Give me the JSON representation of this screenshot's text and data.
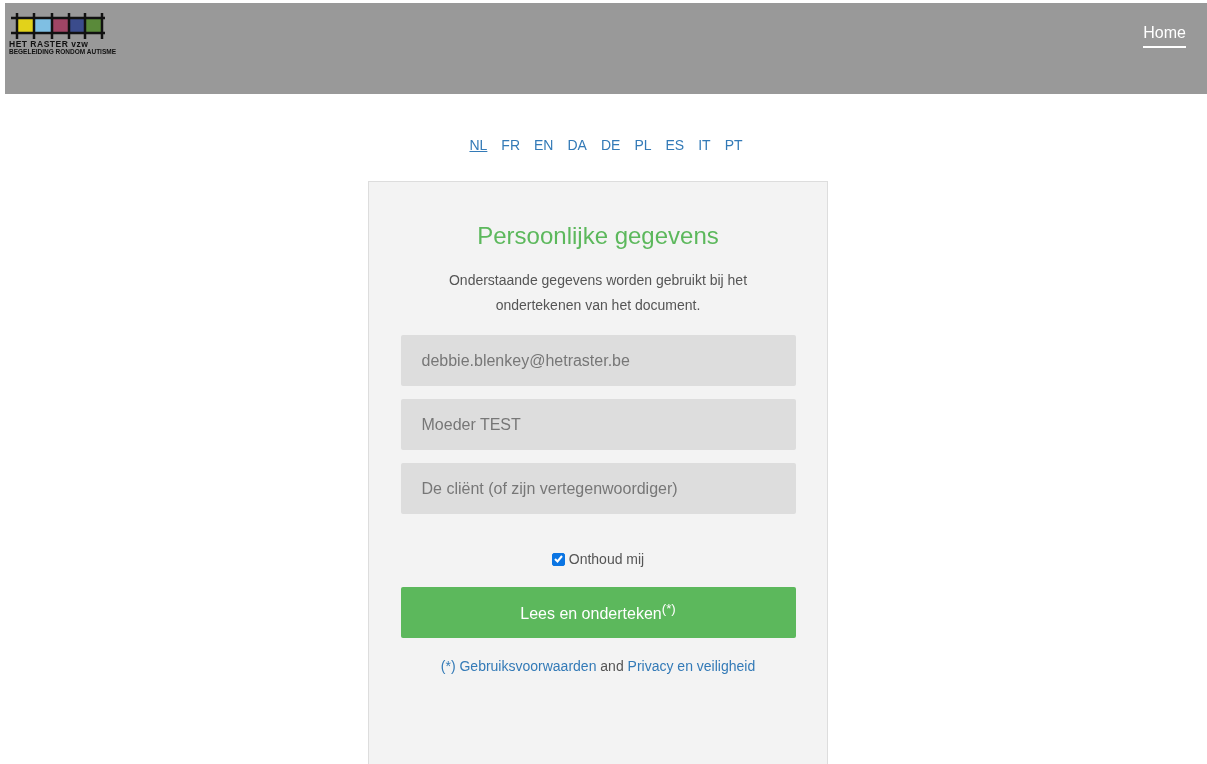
{
  "header": {
    "logo": {
      "name": "HET RASTER vzw",
      "tagline": "BEGELEIDING RONDOM AUTISME"
    },
    "nav": [
      {
        "label": "Home",
        "selected": true
      }
    ]
  },
  "languages": [
    {
      "label": "NL",
      "selected": true
    },
    {
      "label": "FR",
      "selected": false
    },
    {
      "label": "EN",
      "selected": false
    },
    {
      "label": "DA",
      "selected": false
    },
    {
      "label": "DE",
      "selected": false
    },
    {
      "label": "PL",
      "selected": false
    },
    {
      "label": "ES",
      "selected": false
    },
    {
      "label": "IT",
      "selected": false
    },
    {
      "label": "PT",
      "selected": false
    }
  ],
  "form": {
    "title": "Persoonlijke gegevens",
    "description": "Onderstaande gegevens worden gebruikt bij het ondertekenen van het document.",
    "fields": [
      {
        "value": "debbie.blenkey@hetraster.be"
      },
      {
        "value": "Moeder TEST"
      },
      {
        "placeholder": "De cliënt (of zijn vertegenwoordiger)"
      }
    ],
    "remember": {
      "label": "Onthoud mij",
      "checked": true
    },
    "submit": "Lees en onderteken$^{(*)}$",
    "footer": {
      "link_1": "(*) Gebruiksvoorwaarden",
      "joiner": "and",
      "link_2": "Privacy en veiligheid"
    }
  }
}
